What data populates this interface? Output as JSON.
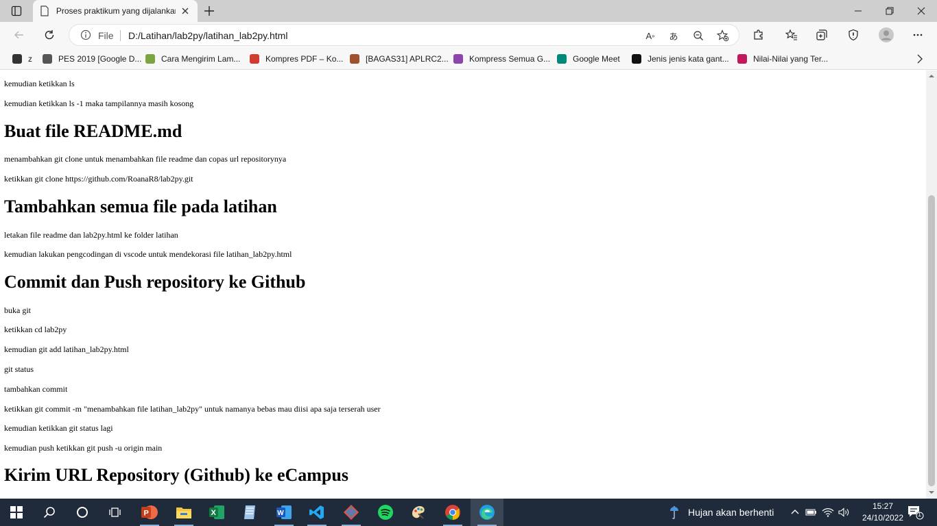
{
  "browser": {
    "tab_title": "Proses praktikum yang dijalankan",
    "address_scheme": "File",
    "address_url": "D:/Latihan/lab2py/latihan_lab2py.html"
  },
  "favorites": [
    {
      "label": "z",
      "color": "#333333"
    },
    {
      "label": "PES 2019 [Google D...",
      "color": "#555555"
    },
    {
      "label": "Cara Mengirim Lam...",
      "color": "#7aa540"
    },
    {
      "label": "Kompres PDF – Ko...",
      "color": "#d23b2f"
    },
    {
      "label": "[BAGAS31] APLRC2...",
      "color": "#a0522d"
    },
    {
      "label": "Kompress Semua G...",
      "color": "#8e44ad"
    },
    {
      "label": "Google Meet",
      "color": "#00897b"
    },
    {
      "label": "Jenis jenis kata gant...",
      "color": "#111111"
    },
    {
      "label": "Nilai-Nilai yang Ter...",
      "color": "#c2185b"
    }
  ],
  "page": {
    "blocks": [
      {
        "type": "p",
        "text": "kemudian ketikkan ls"
      },
      {
        "type": "p",
        "text": "kemudian ketikkan ls -1 maka tampilannya masih kosong"
      },
      {
        "type": "h1",
        "text": "Buat file README.md"
      },
      {
        "type": "p",
        "text": "menambahkan git clone untuk menambahkan file readme dan copas url repositorynya"
      },
      {
        "type": "p",
        "text": "ketikkan git clone https://github.com/RoanaR8/lab2py.git"
      },
      {
        "type": "h1",
        "text": "Tambahkan semua file pada latihan"
      },
      {
        "type": "p",
        "text": "letakan file readme dan lab2py.html ke folder latihan"
      },
      {
        "type": "p",
        "text": "kemudian lakukan pengcodingan di vscode untuk mendekorasi file latihan_lab2py.html"
      },
      {
        "type": "h1",
        "text": "Commit dan Push repository ke Github"
      },
      {
        "type": "p",
        "text": "buka git"
      },
      {
        "type": "p",
        "text": "ketikkan cd lab2py"
      },
      {
        "type": "p",
        "text": "kemudian git add latihan_lab2py.html"
      },
      {
        "type": "p",
        "text": "git status"
      },
      {
        "type": "p",
        "text": "tambahkan commit"
      },
      {
        "type": "p",
        "text": "ketikkan git commit -m \"menambahkan file latihan_lab2py\" untuk namanya bebas mau diisi apa saja terserah user"
      },
      {
        "type": "p",
        "text": "kemudian ketikkan git status lagi"
      },
      {
        "type": "p",
        "text": "kemudian push ketikkan git push -u origin main"
      },
      {
        "type": "h1",
        "text": "Kirim URL Repository (Github) ke eCampus"
      }
    ]
  },
  "taskbar": {
    "apps": [
      "start-icon",
      "search-icon",
      "cortana-icon",
      "task-view-icon",
      "powerpoint-icon",
      "file-explorer-icon",
      "excel-icon",
      "notepad-icon",
      "word-icon",
      "vscode-icon",
      "git-icon",
      "spotify-icon",
      "paint-icon",
      "chrome-icon",
      "edge-icon"
    ],
    "weather_text": "Hujan akan berhenti",
    "time": "15:27",
    "date": "24/10/2022",
    "notification_count": "1"
  }
}
